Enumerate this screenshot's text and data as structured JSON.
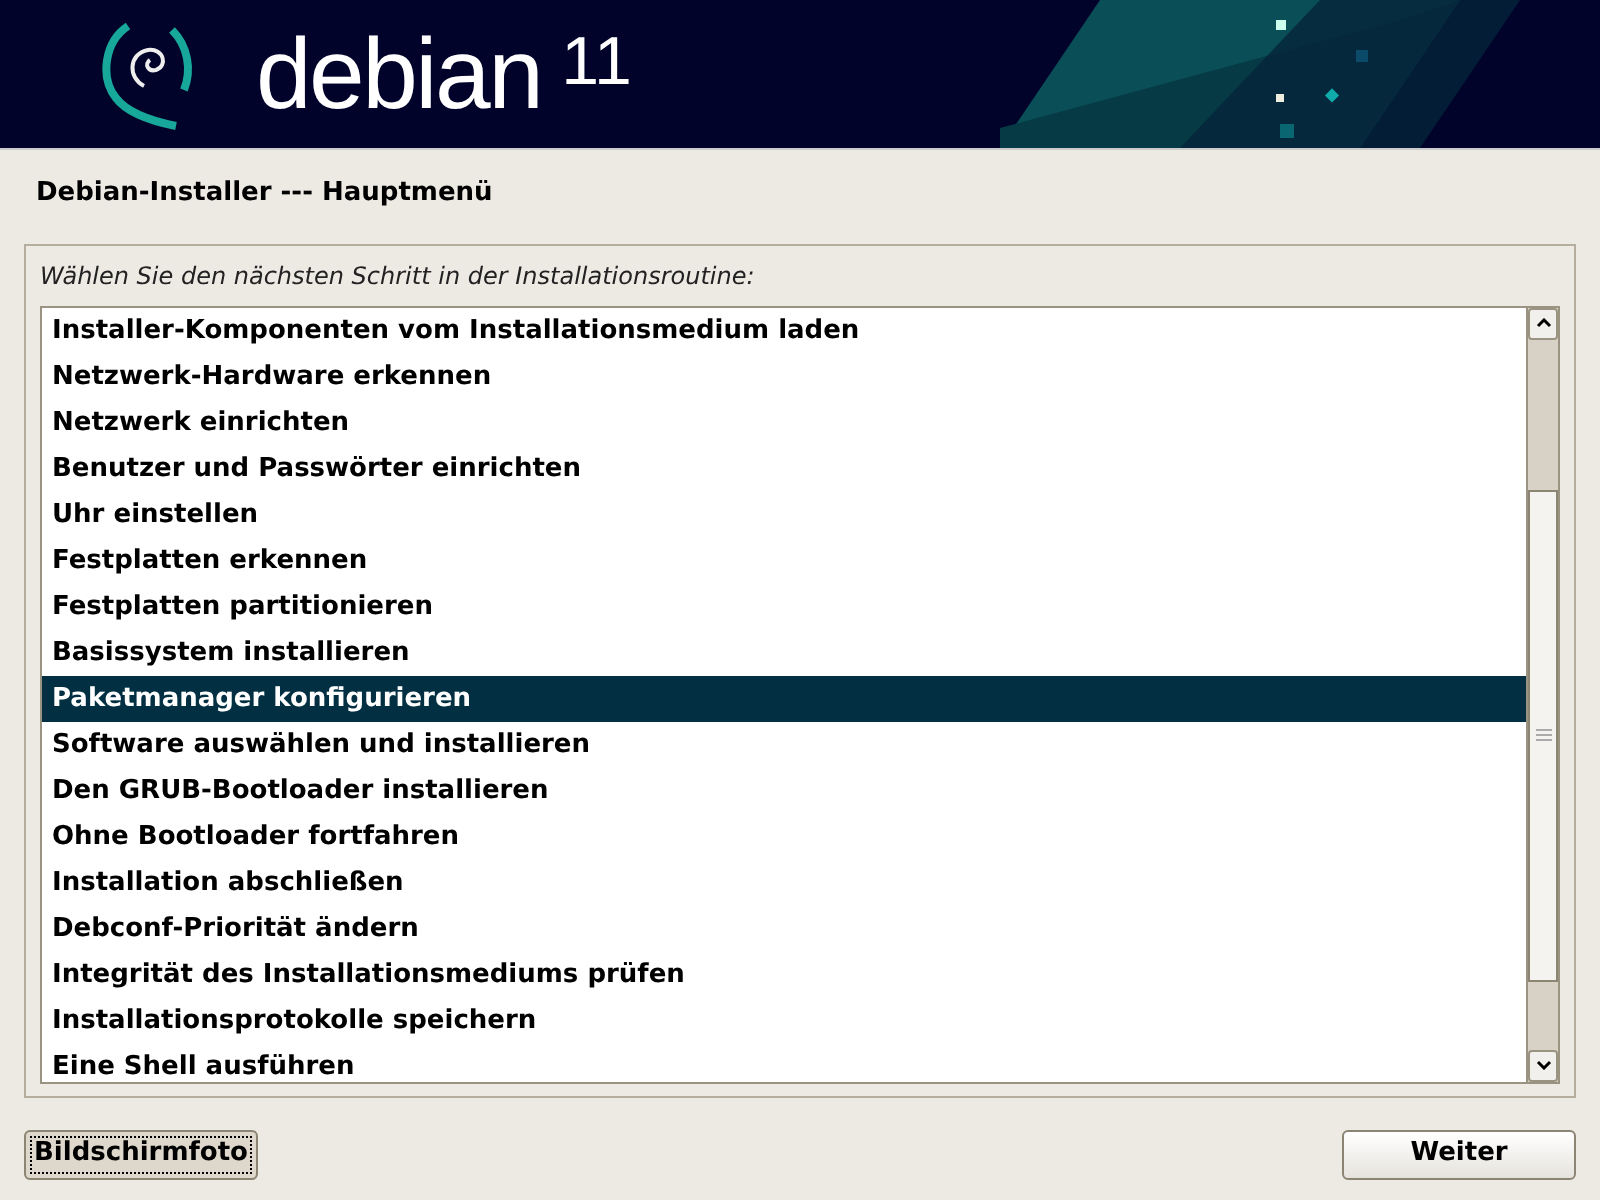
{
  "header": {
    "logo_text": "debian",
    "version": "11"
  },
  "title": "Debian-Installer --- Hauptmenü",
  "prompt": "Wählen Sie den nächsten Schritt in der Installationsroutine:",
  "menu_items": [
    {
      "label": "Installer-Komponenten vom Installationsmedium laden",
      "selected": false
    },
    {
      "label": "Netzwerk-Hardware erkennen",
      "selected": false
    },
    {
      "label": "Netzwerk einrichten",
      "selected": false
    },
    {
      "label": "Benutzer und Passwörter einrichten",
      "selected": false
    },
    {
      "label": "Uhr einstellen",
      "selected": false
    },
    {
      "label": "Festplatten erkennen",
      "selected": false
    },
    {
      "label": "Festplatten partitionieren",
      "selected": false
    },
    {
      "label": "Basissystem installieren",
      "selected": false
    },
    {
      "label": "Paketmanager konfigurieren",
      "selected": true
    },
    {
      "label": "Software auswählen und installieren",
      "selected": false
    },
    {
      "label": "Den GRUB-Bootloader installieren",
      "selected": false
    },
    {
      "label": "Ohne Bootloader fortfahren",
      "selected": false
    },
    {
      "label": "Installation abschließen",
      "selected": false
    },
    {
      "label": "Debconf-Priorität ändern",
      "selected": false
    },
    {
      "label": "Integrität des Installationsmediums prüfen",
      "selected": false
    },
    {
      "label": "Installationsprotokolle speichern",
      "selected": false
    },
    {
      "label": "Eine Shell ausführen",
      "selected": false
    }
  ],
  "buttons": [
    {
      "label": "Bildschirmfoto",
      "focused": true
    },
    {
      "label": "Weiter",
      "focused": false
    }
  ]
}
